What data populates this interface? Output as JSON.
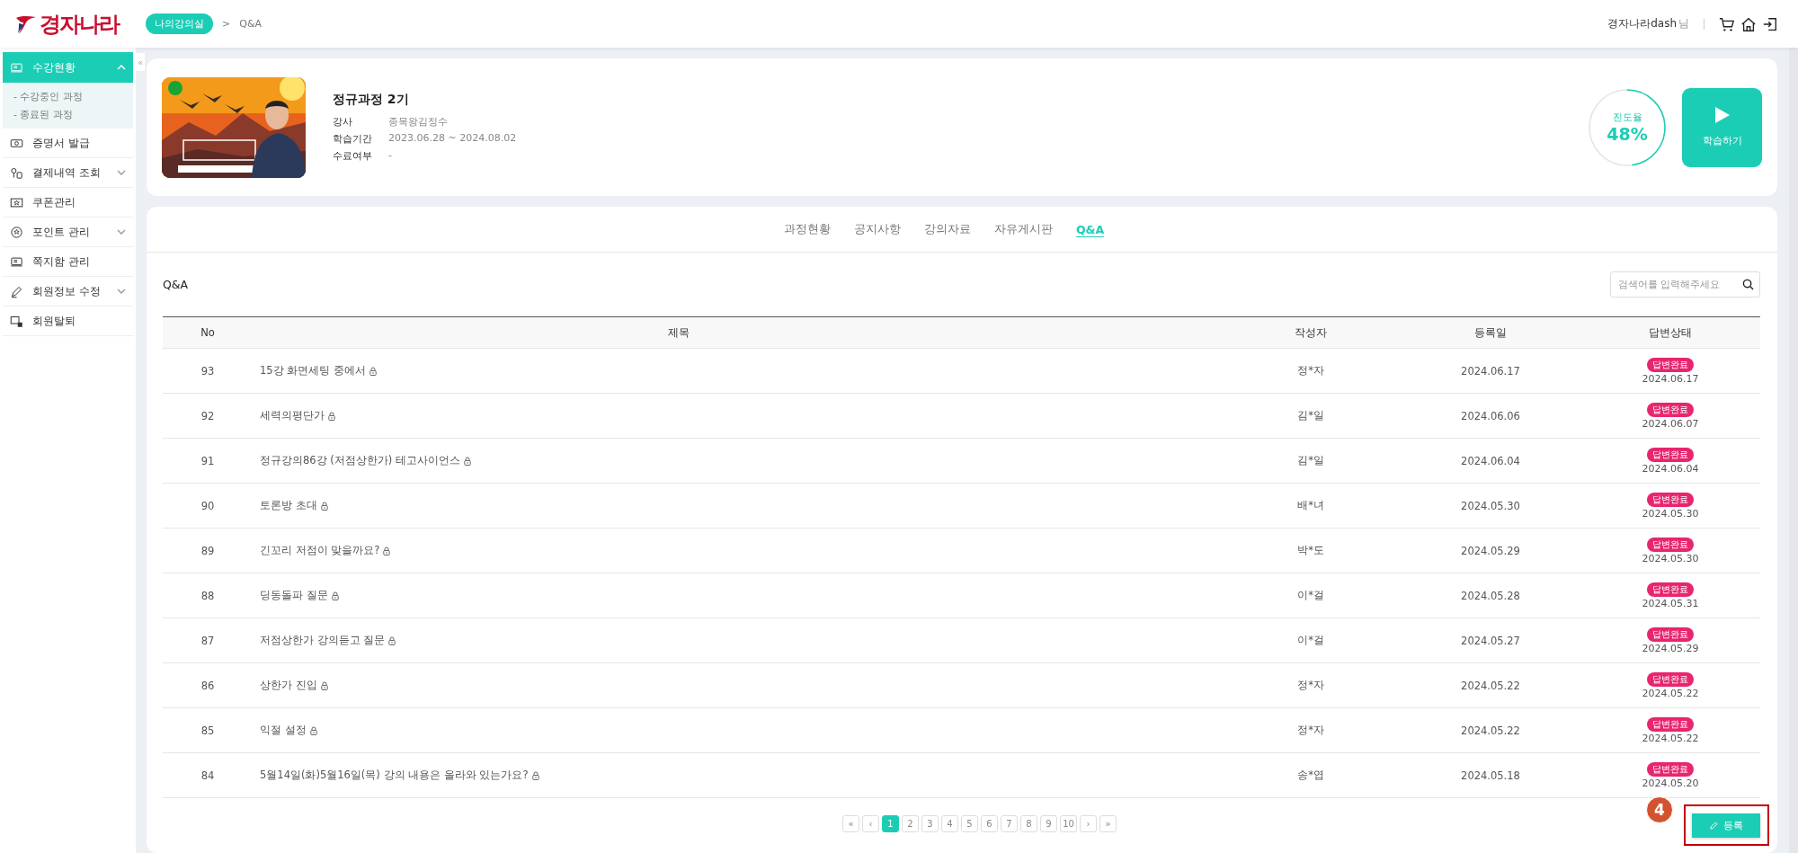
{
  "header": {
    "logo": "경자나라",
    "separator": ">",
    "breadcrumb": [
      {
        "label": "나의강의실",
        "kind": "pill"
      },
      {
        "label": "Q&A",
        "kind": "text"
      }
    ],
    "user": {
      "name": "경자나라dash",
      "suffix": "님"
    }
  },
  "sidebar": {
    "items": [
      {
        "label": "수강현황",
        "kind": "group",
        "selected": true,
        "expanded": true,
        "children": [
          {
            "label": "- 수강중인 과정"
          },
          {
            "label": "- 종료된 과정"
          }
        ]
      },
      {
        "label": "증명서 발급",
        "kind": "link",
        "selected": false
      },
      {
        "label": "결제내역 조회",
        "kind": "group",
        "selected": false,
        "expanded": false
      },
      {
        "label": "쿠폰관리",
        "kind": "link",
        "selected": false
      },
      {
        "label": "포인트 관리",
        "kind": "group",
        "selected": false,
        "expanded": false
      },
      {
        "label": "쪽지함 관리",
        "kind": "link",
        "selected": false
      },
      {
        "label": "회원정보 수정",
        "kind": "group",
        "selected": false,
        "expanded": false
      },
      {
        "label": "회원탈퇴",
        "kind": "link",
        "selected": false
      }
    ]
  },
  "collapse_handle": "«",
  "course": {
    "title": "정규과정 2기",
    "fields": [
      {
        "label": "강사",
        "value": "종목왕김정수"
      },
      {
        "label": "학습기간",
        "value": "2023.06.28 ~ 2024.08.02"
      },
      {
        "label": "수료여부",
        "value": "-"
      }
    ],
    "progress": {
      "label": "진도율",
      "reading": "48%",
      "level": 0.48
    },
    "play_button": "학습하기"
  },
  "tabs": [
    {
      "label": "과정현황",
      "selected": false
    },
    {
      "label": "공지사항",
      "selected": false
    },
    {
      "label": "강의자료",
      "selected": false
    },
    {
      "label": "자유게시판",
      "selected": false
    },
    {
      "label": "Q&A",
      "selected": true
    }
  ],
  "board": {
    "title": "Q&A",
    "search": {
      "placeholder": "검색어를 입력해주세요"
    },
    "columns": [
      "No",
      "제목",
      "작성자",
      "등록일",
      "답변상태"
    ],
    "rows": [
      {
        "no": "93",
        "title": "15강 화면세팅 중에서",
        "locked": true,
        "author": "정*자",
        "date": "2024.06.17",
        "status": "답변완료",
        "answered": "2024.06.17"
      },
      {
        "no": "92",
        "title": "세력의평단가",
        "locked": true,
        "author": "김*일",
        "date": "2024.06.06",
        "status": "답변완료",
        "answered": "2024.06.07"
      },
      {
        "no": "91",
        "title": "정규강의86강 (저점상한가) 테고사이언스",
        "locked": true,
        "author": "김*일",
        "date": "2024.06.04",
        "status": "답변완료",
        "answered": "2024.06.04"
      },
      {
        "no": "90",
        "title": "토론방 초대",
        "locked": true,
        "author": "배*녀",
        "date": "2024.05.30",
        "status": "답변완료",
        "answered": "2024.05.30"
      },
      {
        "no": "89",
        "title": "긴꼬리 저점이 맞을까요?",
        "locked": true,
        "author": "박*도",
        "date": "2024.05.29",
        "status": "답변완료",
        "answered": "2024.05.30"
      },
      {
        "no": "88",
        "title": "딩동돌파 질문",
        "locked": true,
        "author": "이*걸",
        "date": "2024.05.28",
        "status": "답변완료",
        "answered": "2024.05.31"
      },
      {
        "no": "87",
        "title": "저점상한가 강의듣고 질문",
        "locked": true,
        "author": "이*걸",
        "date": "2024.05.27",
        "status": "답변완료",
        "answered": "2024.05.29"
      },
      {
        "no": "86",
        "title": "상한가 진입",
        "locked": true,
        "author": "정*자",
        "date": "2024.05.22",
        "status": "답변완료",
        "answered": "2024.05.22"
      },
      {
        "no": "85",
        "title": "익절 설정",
        "locked": true,
        "author": "정*자",
        "date": "2024.05.22",
        "status": "답변완료",
        "answered": "2024.05.22"
      },
      {
        "no": "84",
        "title": "5월14일(화)5월16일(목) 강의 내용은 올라와 있는가요?",
        "locked": true,
        "author": "송*엽",
        "date": "2024.05.18",
        "status": "답변완료",
        "answered": "2024.05.20"
      }
    ],
    "pagination": {
      "first": "«",
      "prev": "‹",
      "pages": [
        {
          "label": "1",
          "selected": true
        },
        {
          "label": "2",
          "selected": false
        },
        {
          "label": "3",
          "selected": false
        },
        {
          "label": "4",
          "selected": false
        },
        {
          "label": "5",
          "selected": false
        },
        {
          "label": "6",
          "selected": false
        },
        {
          "label": "7",
          "selected": false
        },
        {
          "label": "8",
          "selected": false
        },
        {
          "label": "9",
          "selected": false
        },
        {
          "label": "10",
          "selected": false
        }
      ],
      "next": "›",
      "last": "»"
    },
    "register_button": "등록"
  },
  "annotation": {
    "step": "4"
  }
}
